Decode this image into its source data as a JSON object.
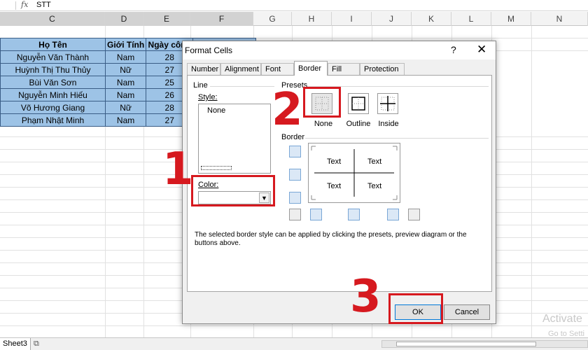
{
  "formula_bar": {
    "fx": "fx",
    "value": "STT"
  },
  "columns": [
    "C",
    "D",
    "E",
    "F",
    "G",
    "H",
    "I",
    "J",
    "K",
    "L",
    "M",
    "N"
  ],
  "table": {
    "headers": [
      "Họ Tên",
      "Giới Tính",
      "Ngày công"
    ],
    "rows": [
      [
        "Nguyễn Văn Thành",
        "Nam",
        "28"
      ],
      [
        "Huỳnh Thị Thu Thủy",
        "Nữ",
        "27"
      ],
      [
        "Bùi Văn Sơn",
        "Nam",
        "25"
      ],
      [
        "Nguyễn Minh Hiếu",
        "Nam",
        "26"
      ],
      [
        "Võ Hương Giang",
        "Nữ",
        "28"
      ],
      [
        "Phạm Nhật Minh",
        "Nam",
        "27"
      ]
    ]
  },
  "sheet_bar": {
    "sheet_name": "Sheet3"
  },
  "watermark": {
    "line1": "Activate",
    "line2": "Go to Setti"
  },
  "dialog": {
    "title": "Format Cells",
    "help": "?",
    "close": "✕",
    "tabs": [
      "Number",
      "Alignment",
      "Font",
      "Border",
      "Fill",
      "Protection"
    ],
    "active_tab": "Border",
    "line_group": "Line",
    "style_label": "Style:",
    "style_none": "None",
    "color_label": "Color:",
    "presets_group": "Presets",
    "presets": [
      "None",
      "Outline",
      "Inside"
    ],
    "border_group": "Border",
    "preview_texts": [
      "Text",
      "Text",
      "Text",
      "Text"
    ],
    "description": "The selected border style can be applied by clicking the presets, preview diagram or the buttons above.",
    "ok": "OK",
    "cancel": "Cancel"
  },
  "annotations": {
    "step1": "1",
    "step2": "2",
    "step3": "3"
  },
  "colors": {
    "annotation_red": "#d6191f",
    "table_fill": "#9dc3e6",
    "table_border": "#3a5d86"
  }
}
